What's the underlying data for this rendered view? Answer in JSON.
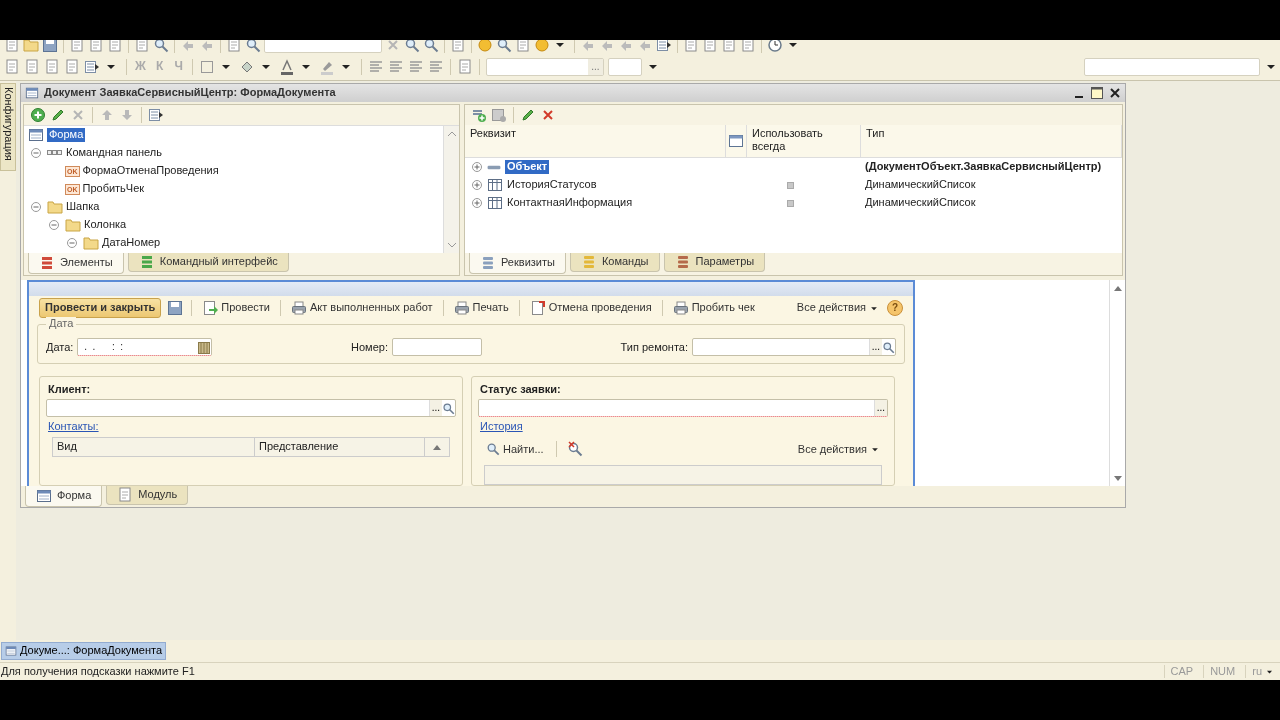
{
  "toolbar": {
    "format_buttons": [
      "Ж",
      "К",
      "Ч"
    ],
    "font_field_button": "..."
  },
  "side_panel": {
    "label": "Конфигурация"
  },
  "window": {
    "title": "Документ ЗаявкаСервисныйЦентр: ФормаДокумента"
  },
  "elements_tree": [
    {
      "label": "Форма",
      "kind": "form",
      "selected": true,
      "children": [
        {
          "label": "Командная панель",
          "kind": "command_bar",
          "expanded": true,
          "selected": false,
          "children": [
            {
              "label": "ФормаОтменаПроведения",
              "kind": "button",
              "badge": "OK",
              "selected": false
            },
            {
              "label": "ПробитьЧек",
              "kind": "button",
              "badge": "OK",
              "selected": false
            }
          ]
        },
        {
          "label": "Шапка",
          "kind": "group",
          "expanded": true,
          "selected": false,
          "children": [
            {
              "label": "Колонка",
              "kind": "group",
              "expanded": true,
              "selected": false,
              "children": [
                {
                  "label": "ДатаНомер",
                  "kind": "group",
                  "expanded": true,
                  "selected": false
                }
              ]
            }
          ]
        }
      ]
    }
  ],
  "left_tabs": [
    {
      "label": "Элементы",
      "selected": true
    },
    {
      "label": "Командный интерфейс",
      "selected": false
    }
  ],
  "attributes": {
    "columns": [
      "Реквизит",
      "Использовать всегда",
      "Тип"
    ],
    "rows": [
      {
        "name": "Объект",
        "kind": "object",
        "expanded": false,
        "selected": true,
        "type": "(ДокументОбъект.ЗаявкаСервисныйЦентр)"
      },
      {
        "name": "ИсторияСтатусов",
        "kind": "table",
        "expanded": false,
        "selected": false,
        "use_always": false,
        "type": "ДинамическийСписок"
      },
      {
        "name": "КонтактнаяИнформация",
        "kind": "table",
        "expanded": false,
        "selected": false,
        "use_always": false,
        "type": "ДинамическийСписок"
      }
    ]
  },
  "right_tabs": [
    {
      "label": "Реквизиты",
      "selected": true
    },
    {
      "label": "Команды",
      "selected": false
    },
    {
      "label": "Параметры",
      "selected": false
    }
  ],
  "form_preview": {
    "commands": [
      {
        "kind": "default",
        "label": "Провести и закрыть"
      },
      {
        "kind": "save"
      },
      {
        "kind": "post",
        "label": "Провести"
      },
      {
        "kind": "print",
        "label": "Акт выполненных работ"
      },
      {
        "kind": "print",
        "label": "Печать"
      },
      {
        "kind": "unpost",
        "label": "Отмена проведения"
      },
      {
        "kind": "print",
        "label": "Пробить чек"
      }
    ],
    "all_actions": "Все действия",
    "help_button": "?",
    "date_group": {
      "title": "Дата",
      "date_label": "Дата:",
      "date_value": " .  .      :  : ",
      "number_label": "Номер:",
      "repair_label": "Тип ремонта:",
      "repair_select_button": "..."
    },
    "client": {
      "title": "Клиент:",
      "select_button": "...",
      "link": "Контакты:",
      "columns": [
        "Вид",
        "Представление"
      ]
    },
    "status": {
      "title": "Статус заявки:",
      "select_button": "...",
      "link": "История",
      "find": "Найти...",
      "all_actions": "Все действия"
    }
  },
  "bottom_tabs": [
    {
      "label": "Форма",
      "selected": true
    },
    {
      "label": "Модуль",
      "selected": false
    }
  ],
  "taskbar": [
    {
      "label": "Докуме...: ФормаДокумента",
      "selected": true
    }
  ],
  "status_bar": {
    "hint": "Для получения подсказки нажмите F1",
    "indicators": [
      "CAP",
      "NUM"
    ],
    "language": "ru"
  }
}
